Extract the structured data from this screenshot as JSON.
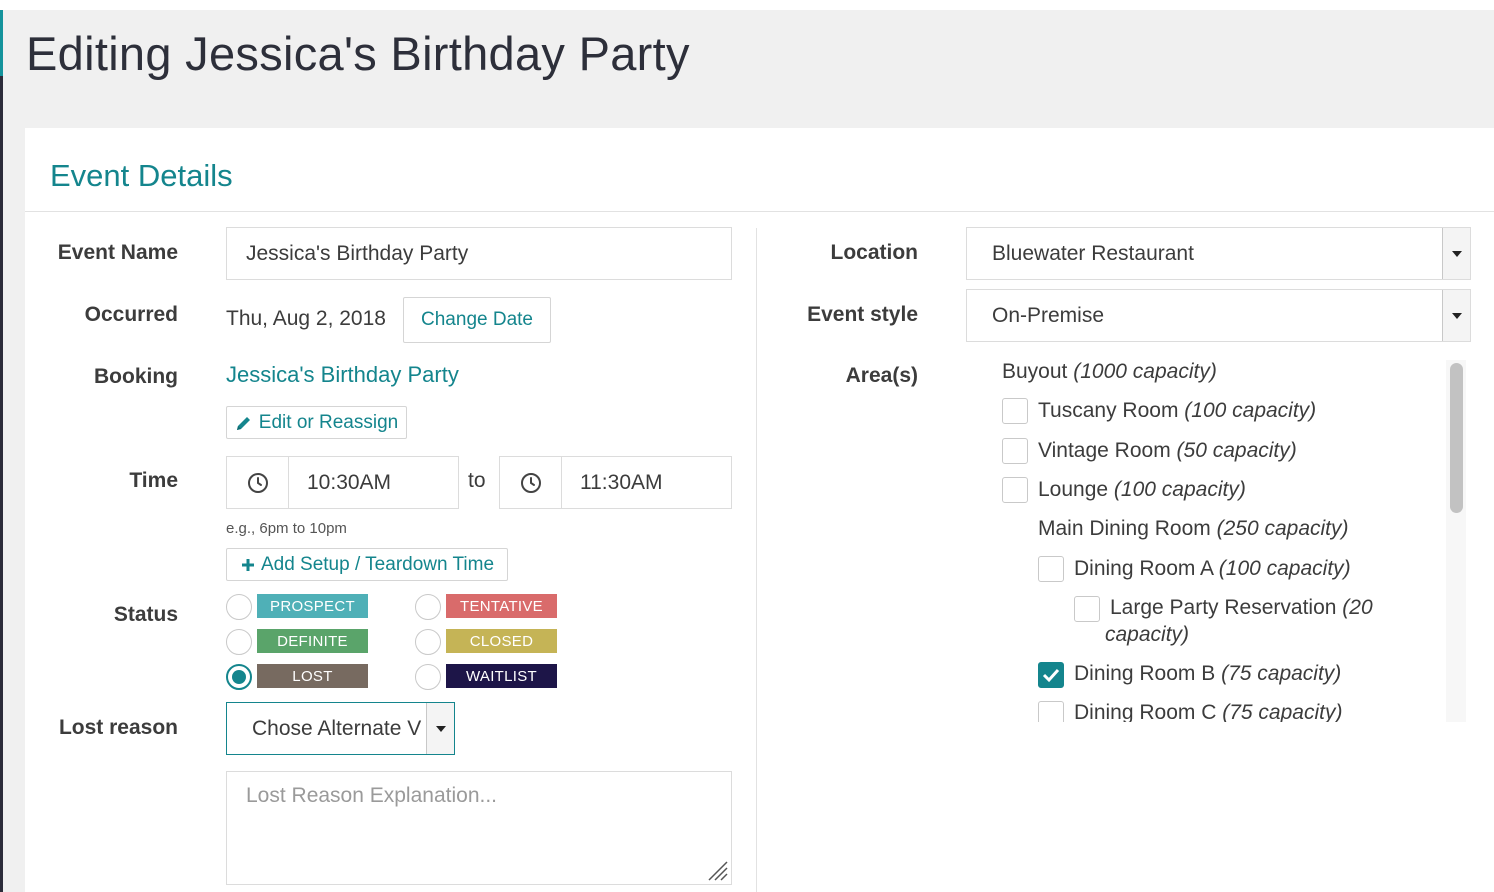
{
  "page": {
    "title": "Editing Jessica's Birthday Party"
  },
  "panel": {
    "title": "Event Details"
  },
  "left": {
    "event_name_label": "Event Name",
    "event_name_value": "Jessica's Birthday Party",
    "occurred_label": "Occurred",
    "occurred_value": "Thu, Aug 2, 2018",
    "change_date_label": "Change Date",
    "booking_label": "Booking",
    "booking_link": "Jessica's Birthday Party",
    "edit_reassign_label": "Edit or Reassign",
    "time_label": "Time",
    "time_start": "10:30AM",
    "time_to": "to",
    "time_end": "11:30AM",
    "time_hint": "e.g., 6pm to 10pm",
    "add_setup_label": "Add Setup / Teardown Time",
    "status_label": "Status",
    "statuses": [
      {
        "label": "PROSPECT",
        "color": "#4fb0b7",
        "checked": false
      },
      {
        "label": "TENTATIVE",
        "color": "#d96b6b",
        "checked": false
      },
      {
        "label": "DEFINITE",
        "color": "#5aa46a",
        "checked": false
      },
      {
        "label": "CLOSED",
        "color": "#c5b456",
        "checked": false
      },
      {
        "label": "LOST",
        "color": "#776a60",
        "checked": true
      },
      {
        "label": "WAITLIST",
        "color": "#1d1548",
        "checked": false
      }
    ],
    "lost_reason_label": "Lost reason",
    "lost_reason_value": "Chose Alternate V",
    "lost_reason_placeholder": "Lost Reason Explanation..."
  },
  "right": {
    "location_label": "Location",
    "location_value": "Bluewater Restaurant",
    "event_style_label": "Event style",
    "event_style_value": "On-Premise",
    "areas_label": "Area(s)",
    "areas": [
      {
        "name": "Buyout",
        "capacity": "(1000 capacity)",
        "checkbox": false,
        "checked": false
      },
      {
        "name": "Tuscany Room",
        "capacity": "(100 capacity)",
        "checkbox": true,
        "checked": false
      },
      {
        "name": "Vintage Room",
        "capacity": "(50 capacity)",
        "checkbox": true,
        "checked": false
      },
      {
        "name": "Lounge",
        "capacity": "(100 capacity)",
        "checkbox": true,
        "checked": false
      },
      {
        "name": "Main Dining Room",
        "capacity": "(250 capacity)",
        "checkbox": false,
        "checked": false
      },
      {
        "name": "Dining Room A",
        "capacity": "(100 capacity)",
        "checkbox": true,
        "checked": false
      },
      {
        "name": "Large Party Reservation",
        "capacity_line1": "(20",
        "capacity_line2": "capacity)",
        "checkbox": true,
        "checked": false
      },
      {
        "name": "Dining Room B",
        "capacity": "(75 capacity)",
        "checkbox": true,
        "checked": true
      },
      {
        "name": "Dining Room C",
        "capacity": "(75 capacity)",
        "checkbox": true,
        "checked": false
      }
    ]
  },
  "colors": {
    "accent": "#14858d",
    "title": "#2d2f3a"
  }
}
